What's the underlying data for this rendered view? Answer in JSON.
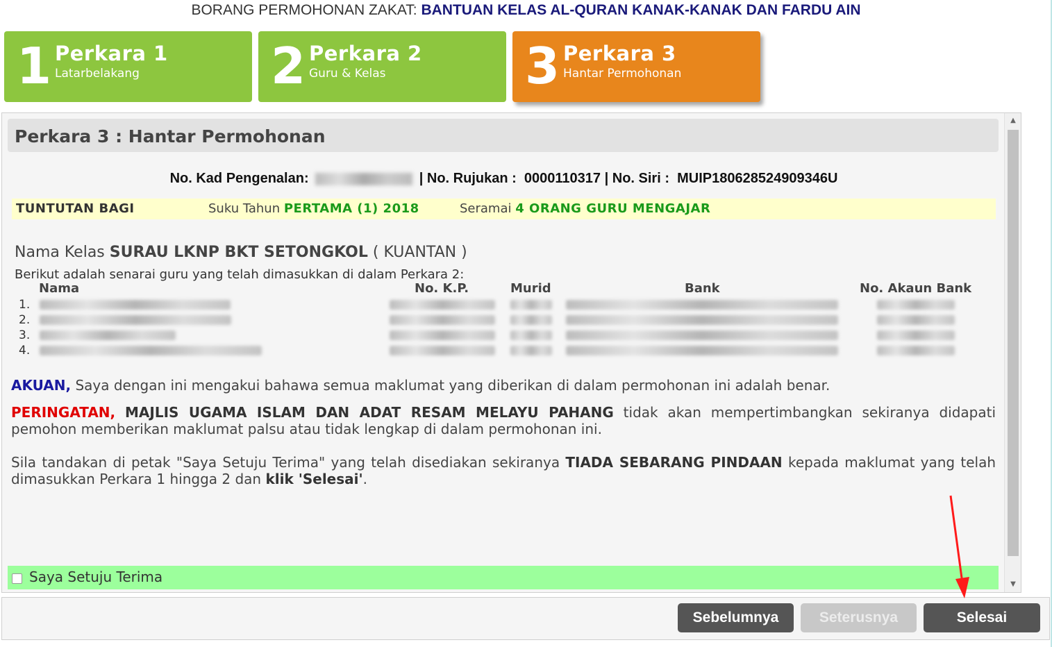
{
  "form_title": {
    "prefix": "BORANG PERMOHONAN ZAKAT:",
    "name": "BANTUAN KELAS AL-QURAN KANAK-KANAK DAN FARDU AIN"
  },
  "steps": [
    {
      "number": "1",
      "title": "Perkara 1",
      "subtitle": "Latarbelakang",
      "state": "done"
    },
    {
      "number": "2",
      "title": "Perkara 2",
      "subtitle": "Guru & Kelas",
      "state": "done"
    },
    {
      "number": "3",
      "title": "Perkara 3",
      "subtitle": "Hantar Permohonan",
      "state": "active"
    }
  ],
  "panel": {
    "title": "Perkara 3 : Hantar Permohonan",
    "id_line": {
      "ic_label": "No. Kad Pengenalan:",
      "ref_label": "| No. Rujukan :",
      "ref_value": "0000110317",
      "serial_label": "| No. Siri :",
      "serial_value": "MUIP180628524909346U"
    },
    "claim": {
      "label": "TUNTUTAN BAGI",
      "term_prefix": "Suku Tahun",
      "term_value": "PERTAMA (1) 2018",
      "count_prefix": "Seramai",
      "count_value": "4 ORANG GURU MENGAJAR"
    },
    "class_line": {
      "prefix": "Nama Kelas",
      "name": "SURAU LKNP BKT SETONGKOL",
      "location": "( KUANTAN )"
    },
    "list_intro": "Berikut adalah senarai guru yang telah dimasukkan di dalam Perkara 2:",
    "table": {
      "headers": {
        "name": "Nama",
        "kp": "No. K.P.",
        "pupils": "Murid",
        "bank": "Bank",
        "account": "No. Akaun Bank"
      },
      "rows": [
        {
          "index": "1."
        },
        {
          "index": "2."
        },
        {
          "index": "3."
        },
        {
          "index": "4."
        }
      ]
    },
    "declaration": {
      "label": "AKUAN,",
      "text": "Saya dengan ini mengakui bahawa semua maklumat yang diberikan di dalam permohonan ini adalah benar."
    },
    "warning": {
      "label": "PERINGATAN,",
      "org": "MAJLIS UGAMA ISLAM DAN ADAT RESAM MELAYU PAHANG",
      "text": "tidak akan mempertimbangkan sekiranya didapati pemohon memberikan maklumat palsu atau tidak lengkap di dalam permohonan ini."
    },
    "instruction": {
      "part1": "Sila tandakan di petak \"Saya Setuju Terima\" yang telah disediakan sekiranya",
      "emphasis": "TIADA SEBARANG PINDAAN",
      "part2": "kepada maklumat yang telah dimasukkan Perkara 1 hingga 2 dan",
      "click": "klik 'Selesai'",
      "end": "."
    },
    "agree_label": "Saya Setuju Terima",
    "agree_checked": false
  },
  "footer": {
    "prev_label": "Sebelumnya",
    "next_label": "Seterusnya",
    "finish_label": "Selesai"
  },
  "colors": {
    "step_done": "#8dc63f",
    "step_active": "#e8861c",
    "claim_bg": "#ffffcc",
    "claim_value": "#1a9a1a",
    "declaration": "#1a1aa0",
    "warning": "#e00000",
    "agree_bg": "#9cff9c",
    "button": "#555555",
    "button_disabled": "#c8c8c8"
  }
}
